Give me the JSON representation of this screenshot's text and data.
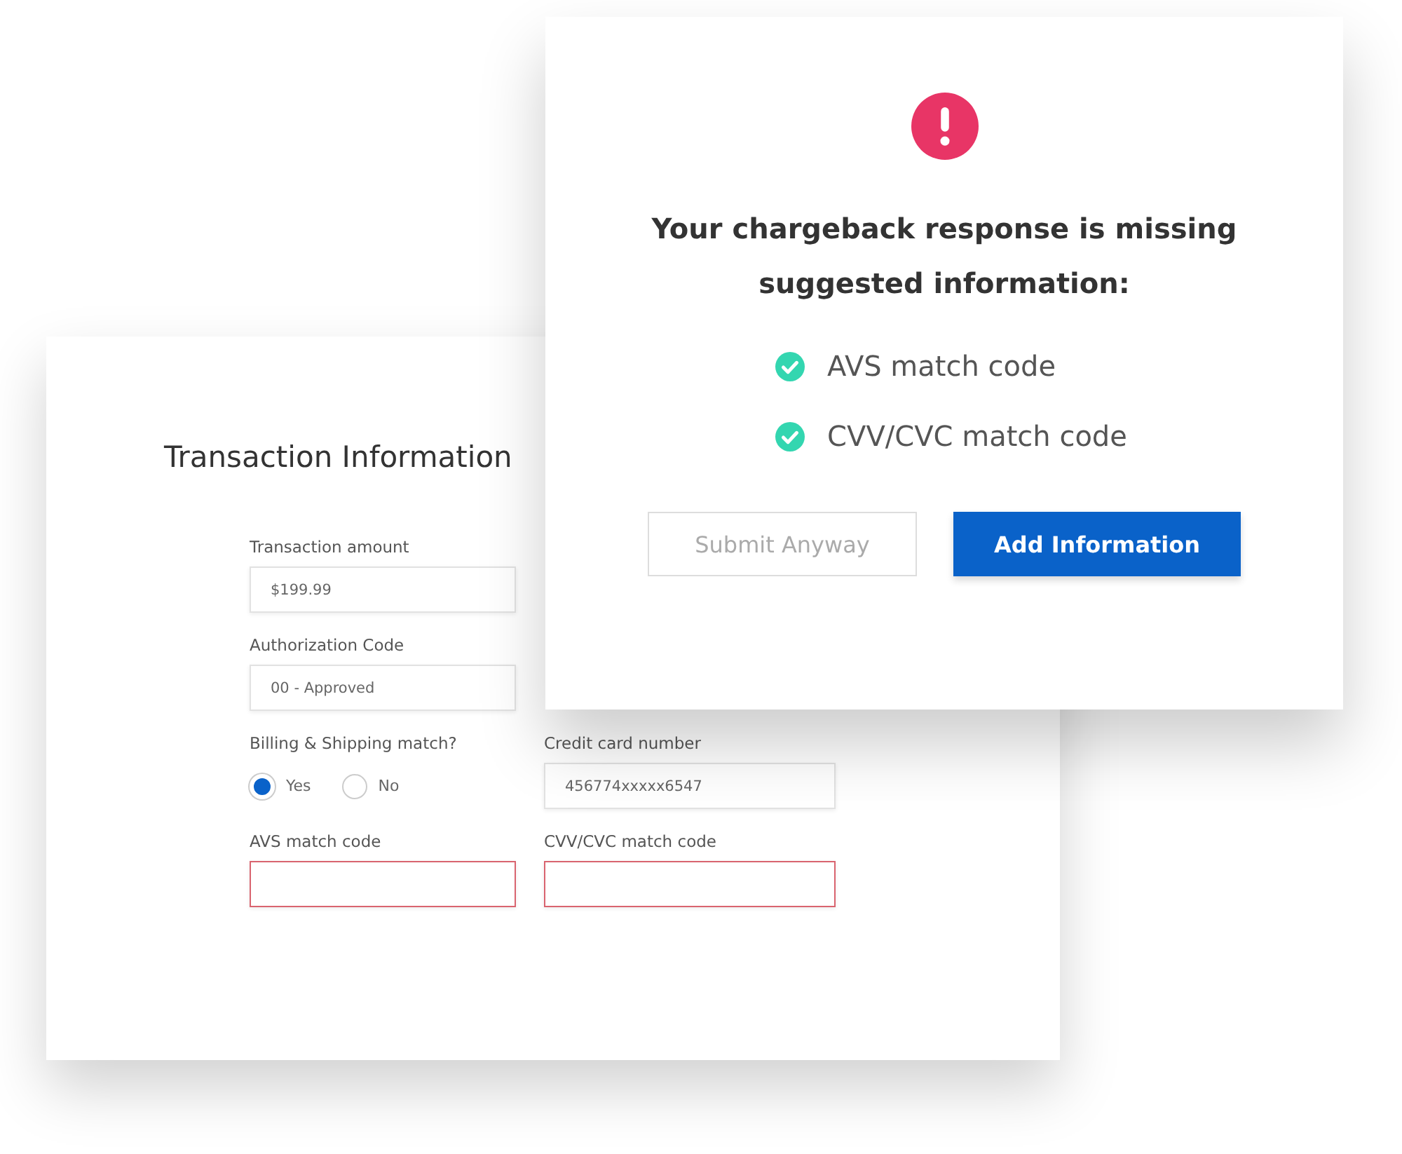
{
  "form": {
    "title": "Transaction Information",
    "rows": [
      [
        {
          "kind": "text",
          "label": "Transaction amount",
          "value": "$199.99",
          "error": false
        }
      ],
      [
        {
          "kind": "text",
          "label": "Authorization Code",
          "value": "00 - Approved",
          "error": false
        }
      ],
      [
        {
          "kind": "radio",
          "label": "Billing & Shipping match?",
          "options": [
            {
              "label": "Yes",
              "selected": true
            },
            {
              "label": "No",
              "selected": false
            }
          ]
        },
        {
          "kind": "text",
          "label": "Credit card number",
          "value": "456774xxxxx6547",
          "error": false
        }
      ],
      [
        {
          "kind": "text",
          "label": "AVS match code",
          "error": true
        },
        {
          "kind": "text",
          "label": "CVV/CVC match code",
          "error": true
        }
      ]
    ]
  },
  "dialog": {
    "message": "Your chargeback response is missing suggested information:",
    "missing": [
      {
        "label": "AVS match code",
        "checked": true
      },
      {
        "label": "CVV/CVC match code",
        "checked": true
      }
    ],
    "buttons": [
      {
        "label": "Submit Anyway",
        "kind": "secondary"
      },
      {
        "label": "Add Information",
        "kind": "primary"
      }
    ]
  }
}
